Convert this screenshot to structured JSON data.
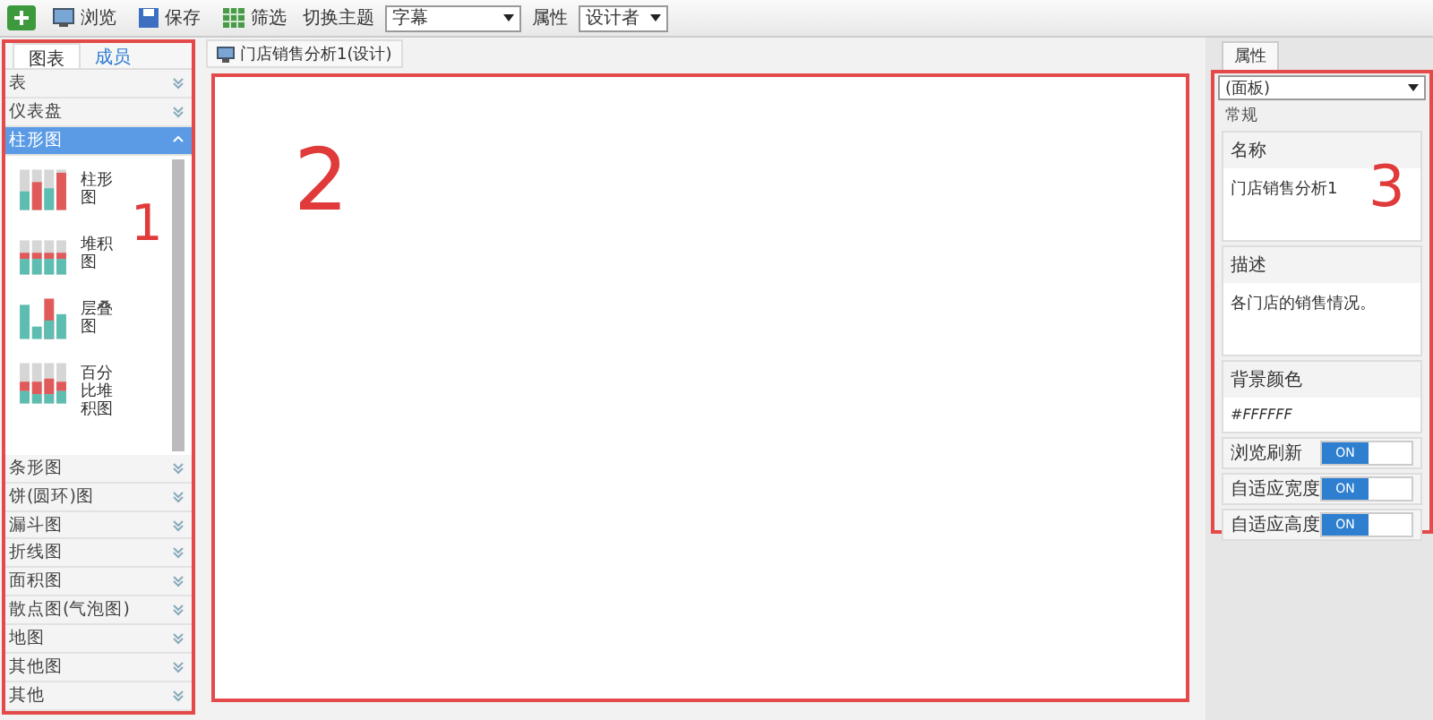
{
  "toolbar": {
    "buttons": [
      {
        "kind": "add"
      },
      {
        "kind": "preview",
        "label": "浏览"
      },
      {
        "kind": "save",
        "label": "保存"
      },
      {
        "kind": "filter",
        "label": "筛选"
      }
    ],
    "theme_label": "切换主题",
    "theme_value": "字幕",
    "props_label": "属性",
    "props_value": "设计者"
  },
  "left_panel": {
    "tabs": [
      {
        "label": "图表",
        "selected": true
      },
      {
        "label": "成员",
        "selected": false
      }
    ],
    "categories": [
      {
        "label": "表",
        "expanded": false
      },
      {
        "label": "仪表盘",
        "expanded": false
      },
      {
        "label": "柱形图",
        "expanded": true,
        "items": [
          {
            "kind": "column",
            "label": "柱形图"
          },
          {
            "kind": "stacked",
            "label": "堆积图"
          },
          {
            "kind": "overlap",
            "label": "层叠图"
          },
          {
            "kind": "percent",
            "label": "百分比堆积图"
          }
        ]
      },
      {
        "label": "条形图",
        "expanded": false
      },
      {
        "label": "饼(圆环)图",
        "expanded": false
      },
      {
        "label": "漏斗图",
        "expanded": false
      },
      {
        "label": "折线图",
        "expanded": false
      },
      {
        "label": "面积图",
        "expanded": false
      },
      {
        "label": "散点图(气泡图)",
        "expanded": false
      },
      {
        "label": "地图",
        "expanded": false
      },
      {
        "label": "其他图",
        "expanded": false
      },
      {
        "label": "其他",
        "expanded": false
      }
    ]
  },
  "document_tab": {
    "label": "门店销售分析1(设计)"
  },
  "right_panel": {
    "tab": "属性",
    "object_select": "(面板)",
    "section": "常规",
    "fields": [
      {
        "label": "名称",
        "value": "门店销售分析1"
      },
      {
        "label": "描述",
        "value": "各门店的销售情况。"
      },
      {
        "label": "背景颜色",
        "value": "#FFFFFF"
      }
    ],
    "toggles": [
      {
        "label": "浏览刷新",
        "on": true,
        "text": "ON"
      },
      {
        "label": "自适应宽度",
        "on": true,
        "text": "ON"
      },
      {
        "label": "自适应高度",
        "on": true,
        "text": "ON"
      }
    ]
  },
  "annotations": [
    "1",
    "2",
    "3"
  ]
}
